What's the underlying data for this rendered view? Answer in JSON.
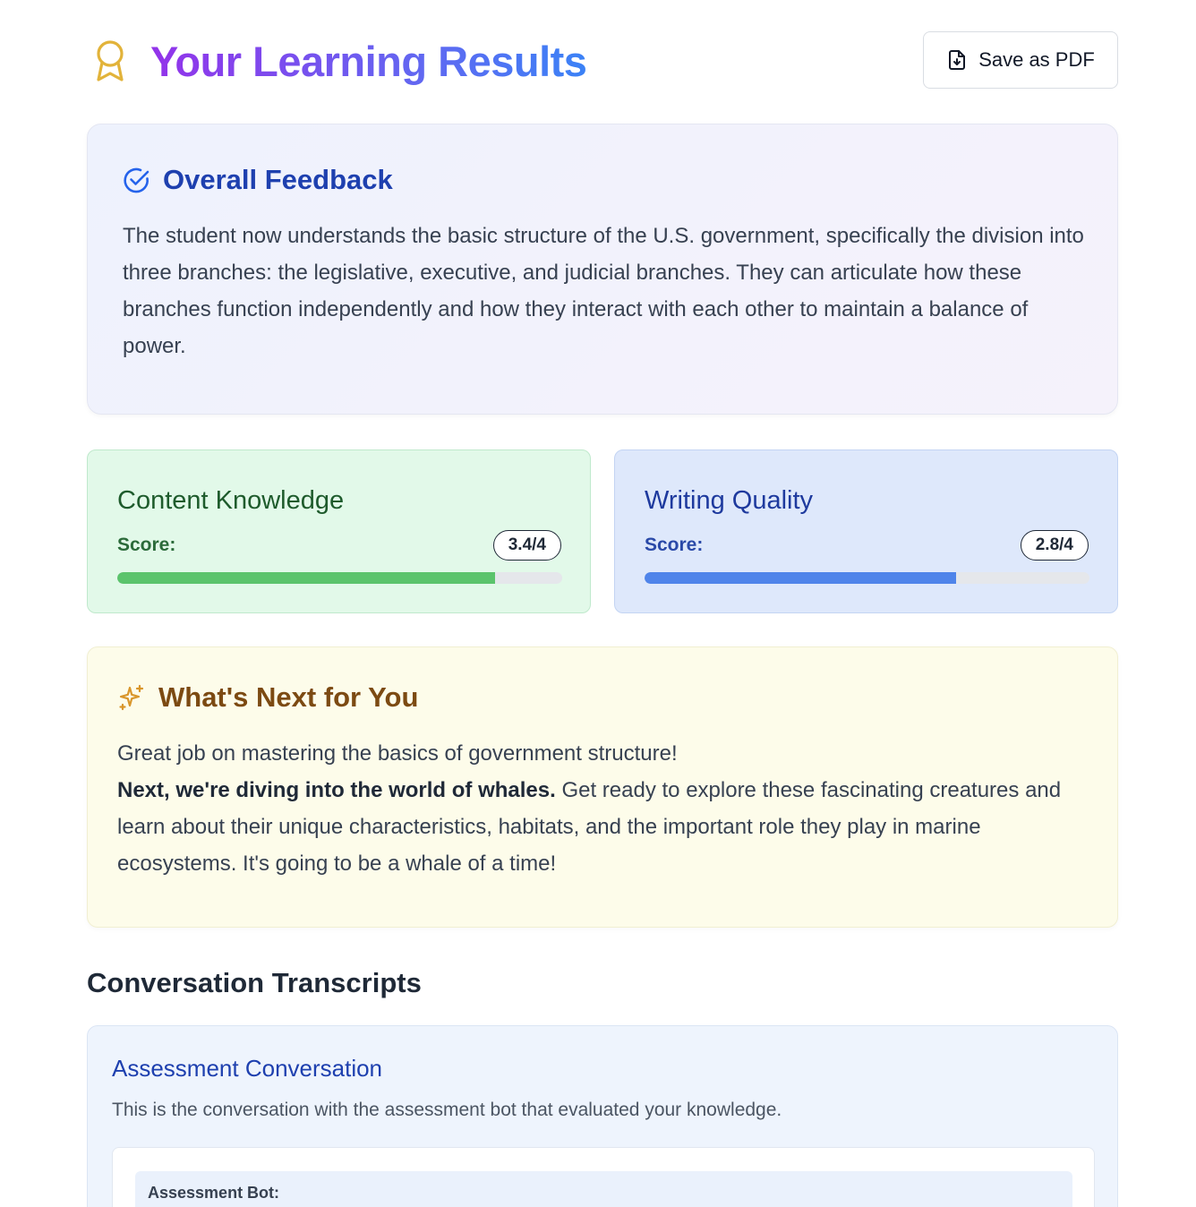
{
  "header": {
    "title": "Your Learning Results",
    "icon": "award-icon",
    "pdf_button": {
      "label": "Save as PDF",
      "icon": "file-download-icon"
    }
  },
  "overall_feedback": {
    "icon": "check-circle-icon",
    "title": "Overall Feedback",
    "text": "The student now understands the basic structure of the U.S. government, specifically the division into three branches: the legislative, executive, and judicial branches. They can articulate how these branches function independently and how they interact with each other to maintain a balance of power."
  },
  "scores": [
    {
      "title": "Content Knowledge",
      "label": "Score:",
      "badge": "3.4/4",
      "fraction": 0.85,
      "color": "#5bc46c"
    },
    {
      "title": "Writing Quality",
      "label": "Score:",
      "badge": "2.8/4",
      "fraction": 0.7,
      "color": "#4f84ea"
    }
  ],
  "whats_next": {
    "icon": "sparkles-icon",
    "title": "What's Next for You",
    "line1": "Great job on mastering the basics of government structure!",
    "bold": "Next, we're diving into the world of whales.",
    "rest": " Get ready to explore these fascinating creatures and learn about their unique characteristics, habitats, and the important role they play in marine ecosystems. It's going to be a whale of a time!"
  },
  "transcripts": {
    "title": "Conversation Transcripts",
    "conversation": {
      "title": "Assessment Conversation",
      "description": "This is the conversation with the assessment bot that evaluated your knowledge.",
      "messages": [
        {
          "sender": "Assessment Bot:"
        }
      ]
    }
  },
  "colors": {
    "title_gradient": [
      "#9333ea",
      "#6366f1",
      "#3b82f6"
    ],
    "award_icon": "#e2b33a",
    "feedback_accent": "#1e40af",
    "next_accent": "#7c4a12"
  }
}
